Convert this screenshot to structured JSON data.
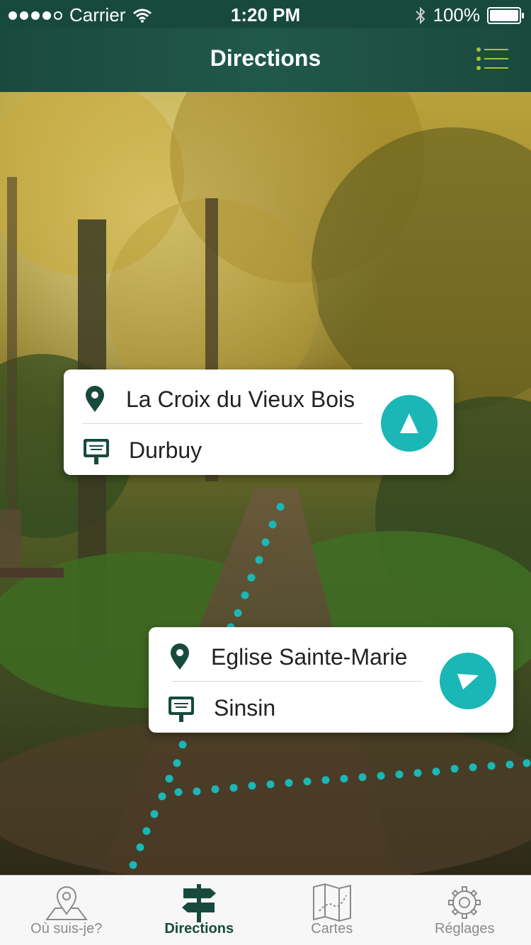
{
  "status": {
    "carrier": "Carrier",
    "time": "1:20 PM",
    "battery": "100%"
  },
  "nav": {
    "title": "Directions",
    "menu_icon": "list-icon"
  },
  "colors": {
    "primary": "#174a3d",
    "accent": "#1ab7b6",
    "accent_lime": "#a6c23a"
  },
  "cards": [
    {
      "place": "La Croix du Vieux Bois",
      "village": "Durbuy",
      "direction_icon": "arrow-up-icon"
    },
    {
      "place": "Eglise Sainte-Marie",
      "village": "Sinsin",
      "direction_icon": "arrow-right-icon"
    }
  ],
  "tabs": [
    {
      "label": "Où suis-je?",
      "icon": "map-pin-icon",
      "active": false
    },
    {
      "label": "Directions",
      "icon": "signpost-icon",
      "active": true
    },
    {
      "label": "Cartes",
      "icon": "map-icon",
      "active": false
    },
    {
      "label": "Réglages",
      "icon": "gear-icon",
      "active": false
    }
  ]
}
